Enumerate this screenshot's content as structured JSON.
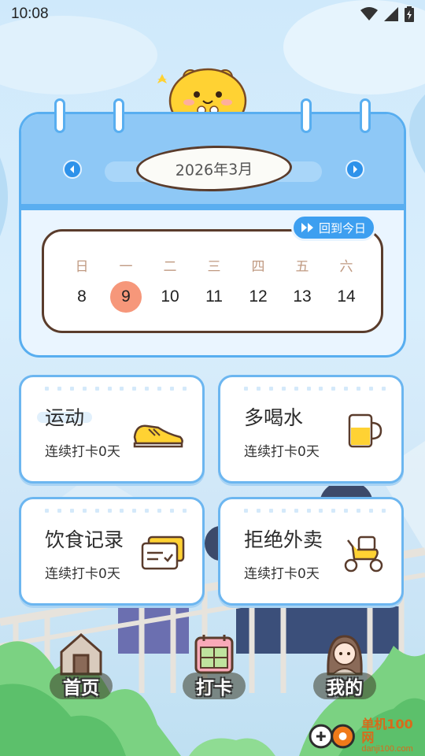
{
  "status_bar": {
    "time": "10:08"
  },
  "calendar": {
    "month_label": "2026年3月",
    "today_button_label": "回到今日",
    "weekdays": [
      "日",
      "一",
      "二",
      "三",
      "四",
      "五",
      "六"
    ],
    "dates": [
      "8",
      "9",
      "10",
      "11",
      "12",
      "13",
      "14"
    ],
    "selected_date": "9"
  },
  "habits": [
    {
      "title": "运动",
      "subtitle": "连续打卡0天",
      "icon": "sneaker-icon"
    },
    {
      "title": "多喝水",
      "subtitle": "连续打卡0天",
      "icon": "mug-icon"
    },
    {
      "title": "饮食记录",
      "subtitle": "连续打卡0天",
      "icon": "receipt-icon"
    },
    {
      "title": "拒绝外卖",
      "subtitle": "连续打卡0天",
      "icon": "scooter-icon"
    }
  ],
  "bottom_nav": {
    "items": [
      {
        "label": "首页",
        "icon": "house-icon"
      },
      {
        "label": "打卡",
        "icon": "calendar-icon"
      },
      {
        "label": "我的",
        "icon": "girl-avatar-icon"
      }
    ]
  },
  "watermark": {
    "line1": "单机100网",
    "line2": "danji100.com"
  },
  "colors": {
    "accent_blue": "#58aef0",
    "header_blue": "#8ec8f6",
    "selected_date": "#f6977a",
    "outline_brown": "#5a3c2c"
  }
}
